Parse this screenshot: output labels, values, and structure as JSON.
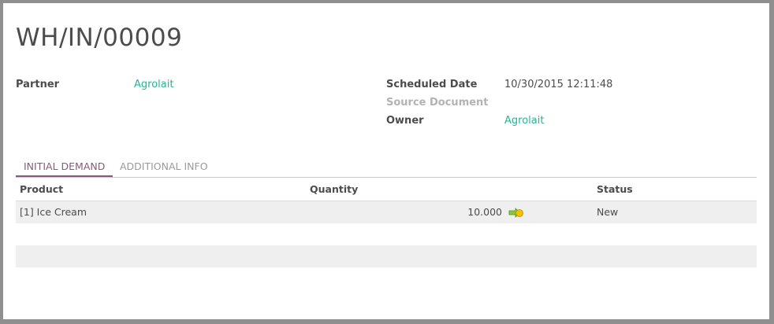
{
  "record": {
    "title": "WH/IN/00009"
  },
  "fields": {
    "partner_label": "Partner",
    "partner_value": "Agrolait",
    "scheduled_date_label": "Scheduled Date",
    "scheduled_date_value": "10/30/2015 12:11:48",
    "source_document_label": "Source Document",
    "source_document_value": "",
    "owner_label": "Owner",
    "owner_value": "Agrolait"
  },
  "tabs": [
    {
      "label": "INITIAL DEMAND",
      "active": true
    },
    {
      "label": "ADDITIONAL INFO",
      "active": false
    }
  ],
  "table": {
    "headers": {
      "product": "Product",
      "quantity": "Quantity",
      "status": "Status"
    },
    "rows": [
      {
        "product": "[1] Ice Cream",
        "quantity": "10.000",
        "status": "New",
        "action_icon": "move-arrow-icon"
      }
    ]
  },
  "colors": {
    "link": "#21b799",
    "active_tab": "#875a7b",
    "row_background": "#efefef"
  }
}
